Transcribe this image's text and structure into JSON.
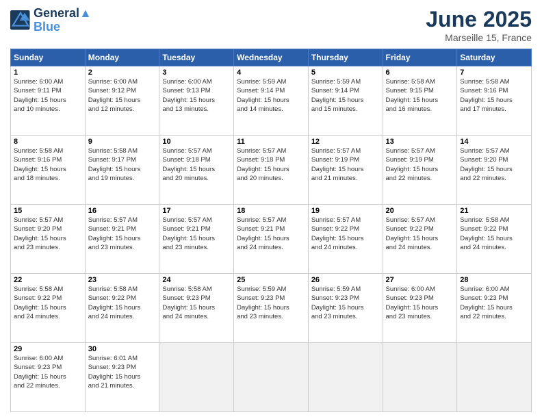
{
  "header": {
    "logo_line1": "General",
    "logo_line2": "Blue",
    "month_title": "June 2025",
    "location": "Marseille 15, France"
  },
  "calendar": {
    "headers": [
      "Sunday",
      "Monday",
      "Tuesday",
      "Wednesday",
      "Thursday",
      "Friday",
      "Saturday"
    ],
    "rows": [
      [
        {
          "day": "1",
          "lines": [
            "Sunrise: 6:00 AM",
            "Sunset: 9:11 PM",
            "Daylight: 15 hours",
            "and 10 minutes."
          ]
        },
        {
          "day": "2",
          "lines": [
            "Sunrise: 6:00 AM",
            "Sunset: 9:12 PM",
            "Daylight: 15 hours",
            "and 12 minutes."
          ]
        },
        {
          "day": "3",
          "lines": [
            "Sunrise: 6:00 AM",
            "Sunset: 9:13 PM",
            "Daylight: 15 hours",
            "and 13 minutes."
          ]
        },
        {
          "day": "4",
          "lines": [
            "Sunrise: 5:59 AM",
            "Sunset: 9:14 PM",
            "Daylight: 15 hours",
            "and 14 minutes."
          ]
        },
        {
          "day": "5",
          "lines": [
            "Sunrise: 5:59 AM",
            "Sunset: 9:14 PM",
            "Daylight: 15 hours",
            "and 15 minutes."
          ]
        },
        {
          "day": "6",
          "lines": [
            "Sunrise: 5:58 AM",
            "Sunset: 9:15 PM",
            "Daylight: 15 hours",
            "and 16 minutes."
          ]
        },
        {
          "day": "7",
          "lines": [
            "Sunrise: 5:58 AM",
            "Sunset: 9:16 PM",
            "Daylight: 15 hours",
            "and 17 minutes."
          ]
        }
      ],
      [
        {
          "day": "8",
          "lines": [
            "Sunrise: 5:58 AM",
            "Sunset: 9:16 PM",
            "Daylight: 15 hours",
            "and 18 minutes."
          ]
        },
        {
          "day": "9",
          "lines": [
            "Sunrise: 5:58 AM",
            "Sunset: 9:17 PM",
            "Daylight: 15 hours",
            "and 19 minutes."
          ]
        },
        {
          "day": "10",
          "lines": [
            "Sunrise: 5:57 AM",
            "Sunset: 9:18 PM",
            "Daylight: 15 hours",
            "and 20 minutes."
          ]
        },
        {
          "day": "11",
          "lines": [
            "Sunrise: 5:57 AM",
            "Sunset: 9:18 PM",
            "Daylight: 15 hours",
            "and 20 minutes."
          ]
        },
        {
          "day": "12",
          "lines": [
            "Sunrise: 5:57 AM",
            "Sunset: 9:19 PM",
            "Daylight: 15 hours",
            "and 21 minutes."
          ]
        },
        {
          "day": "13",
          "lines": [
            "Sunrise: 5:57 AM",
            "Sunset: 9:19 PM",
            "Daylight: 15 hours",
            "and 22 minutes."
          ]
        },
        {
          "day": "14",
          "lines": [
            "Sunrise: 5:57 AM",
            "Sunset: 9:20 PM",
            "Daylight: 15 hours",
            "and 22 minutes."
          ]
        }
      ],
      [
        {
          "day": "15",
          "lines": [
            "Sunrise: 5:57 AM",
            "Sunset: 9:20 PM",
            "Daylight: 15 hours",
            "and 23 minutes."
          ]
        },
        {
          "day": "16",
          "lines": [
            "Sunrise: 5:57 AM",
            "Sunset: 9:21 PM",
            "Daylight: 15 hours",
            "and 23 minutes."
          ]
        },
        {
          "day": "17",
          "lines": [
            "Sunrise: 5:57 AM",
            "Sunset: 9:21 PM",
            "Daylight: 15 hours",
            "and 23 minutes."
          ]
        },
        {
          "day": "18",
          "lines": [
            "Sunrise: 5:57 AM",
            "Sunset: 9:21 PM",
            "Daylight: 15 hours",
            "and 24 minutes."
          ]
        },
        {
          "day": "19",
          "lines": [
            "Sunrise: 5:57 AM",
            "Sunset: 9:22 PM",
            "Daylight: 15 hours",
            "and 24 minutes."
          ]
        },
        {
          "day": "20",
          "lines": [
            "Sunrise: 5:57 AM",
            "Sunset: 9:22 PM",
            "Daylight: 15 hours",
            "and 24 minutes."
          ]
        },
        {
          "day": "21",
          "lines": [
            "Sunrise: 5:58 AM",
            "Sunset: 9:22 PM",
            "Daylight: 15 hours",
            "and 24 minutes."
          ]
        }
      ],
      [
        {
          "day": "22",
          "lines": [
            "Sunrise: 5:58 AM",
            "Sunset: 9:22 PM",
            "Daylight: 15 hours",
            "and 24 minutes."
          ]
        },
        {
          "day": "23",
          "lines": [
            "Sunrise: 5:58 AM",
            "Sunset: 9:22 PM",
            "Daylight: 15 hours",
            "and 24 minutes."
          ]
        },
        {
          "day": "24",
          "lines": [
            "Sunrise: 5:58 AM",
            "Sunset: 9:23 PM",
            "Daylight: 15 hours",
            "and 24 minutes."
          ]
        },
        {
          "day": "25",
          "lines": [
            "Sunrise: 5:59 AM",
            "Sunset: 9:23 PM",
            "Daylight: 15 hours",
            "and 23 minutes."
          ]
        },
        {
          "day": "26",
          "lines": [
            "Sunrise: 5:59 AM",
            "Sunset: 9:23 PM",
            "Daylight: 15 hours",
            "and 23 minutes."
          ]
        },
        {
          "day": "27",
          "lines": [
            "Sunrise: 6:00 AM",
            "Sunset: 9:23 PM",
            "Daylight: 15 hours",
            "and 23 minutes."
          ]
        },
        {
          "day": "28",
          "lines": [
            "Sunrise: 6:00 AM",
            "Sunset: 9:23 PM",
            "Daylight: 15 hours",
            "and 22 minutes."
          ]
        }
      ],
      [
        {
          "day": "29",
          "lines": [
            "Sunrise: 6:00 AM",
            "Sunset: 9:23 PM",
            "Daylight: 15 hours",
            "and 22 minutes."
          ]
        },
        {
          "day": "30",
          "lines": [
            "Sunrise: 6:01 AM",
            "Sunset: 9:23 PM",
            "Daylight: 15 hours",
            "and 21 minutes."
          ]
        },
        {
          "day": "",
          "lines": []
        },
        {
          "day": "",
          "lines": []
        },
        {
          "day": "",
          "lines": []
        },
        {
          "day": "",
          "lines": []
        },
        {
          "day": "",
          "lines": []
        }
      ]
    ]
  }
}
